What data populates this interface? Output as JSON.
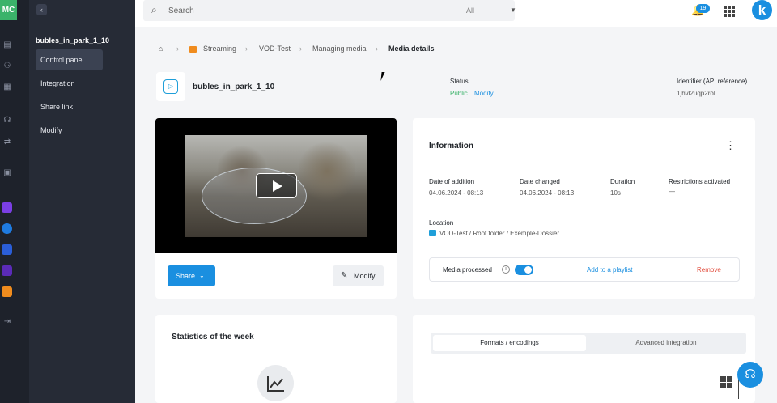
{
  "rail": {
    "avatar_initials": "MC",
    "icons": [
      "media-icon",
      "users-icon",
      "building-icon",
      "headset-icon",
      "network-icon",
      "monitor-icon"
    ],
    "apps": [
      {
        "name": "app-purple-icon",
        "color": "#7b3fe4"
      },
      {
        "name": "app-blue-circle-icon",
        "color": "#1f7be0"
      },
      {
        "name": "app-cube-icon",
        "color": "#2b5ed8"
      },
      {
        "name": "app-violet-icon",
        "color": "#5b2bb8"
      },
      {
        "name": "app-streaming-icon",
        "color": "#f08c1e"
      }
    ],
    "bottom_icon": "logout-icon"
  },
  "subnav": {
    "media_title": "bubles_in_park_1_10",
    "items": [
      {
        "label": "Control panel",
        "active": true
      },
      {
        "label": "Integration"
      },
      {
        "label": "Share link"
      },
      {
        "label": "Modify"
      }
    ]
  },
  "topbar": {
    "search_placeholder": "Search",
    "search_scope": "All",
    "notification_count": "19",
    "logo_letter": "k"
  },
  "breadcrumb": {
    "items": [
      "Streaming",
      "VOD-Test",
      "Managing media"
    ],
    "current": "Media details"
  },
  "header": {
    "title": "bubles_in_park_1_10",
    "status_label": "Status",
    "status_value": "Public",
    "status_modify": "Modify",
    "identifier_label": "Identifier (API reference)",
    "identifier_value": "1jhvl2uqp2rol"
  },
  "video_card": {
    "share_label": "Share",
    "modify_label": "Modify"
  },
  "info": {
    "title": "Information",
    "date_added_label": "Date of addition",
    "date_added_value": "04.06.2024 - 08:13",
    "date_changed_label": "Date changed",
    "date_changed_value": "04.06.2024 - 08:13",
    "duration_label": "Duration",
    "duration_value": "10s",
    "restrictions_label": "Restrictions activated",
    "restrictions_value": "—",
    "location_label": "Location",
    "location_value": "VOD-Test / Root folder / Exemple-Dossier",
    "processed_label": "Media processed",
    "add_playlist": "Add to a playlist",
    "remove": "Remove"
  },
  "stats": {
    "title": "Statistics of the week"
  },
  "formats": {
    "tab_active": "Formats / encodings",
    "tab_other": "Advanced integration"
  },
  "colors": {
    "accent": "#1a8fe0",
    "success": "#3bb36a",
    "danger": "#e24c3c",
    "sidebar": "#262b36"
  }
}
